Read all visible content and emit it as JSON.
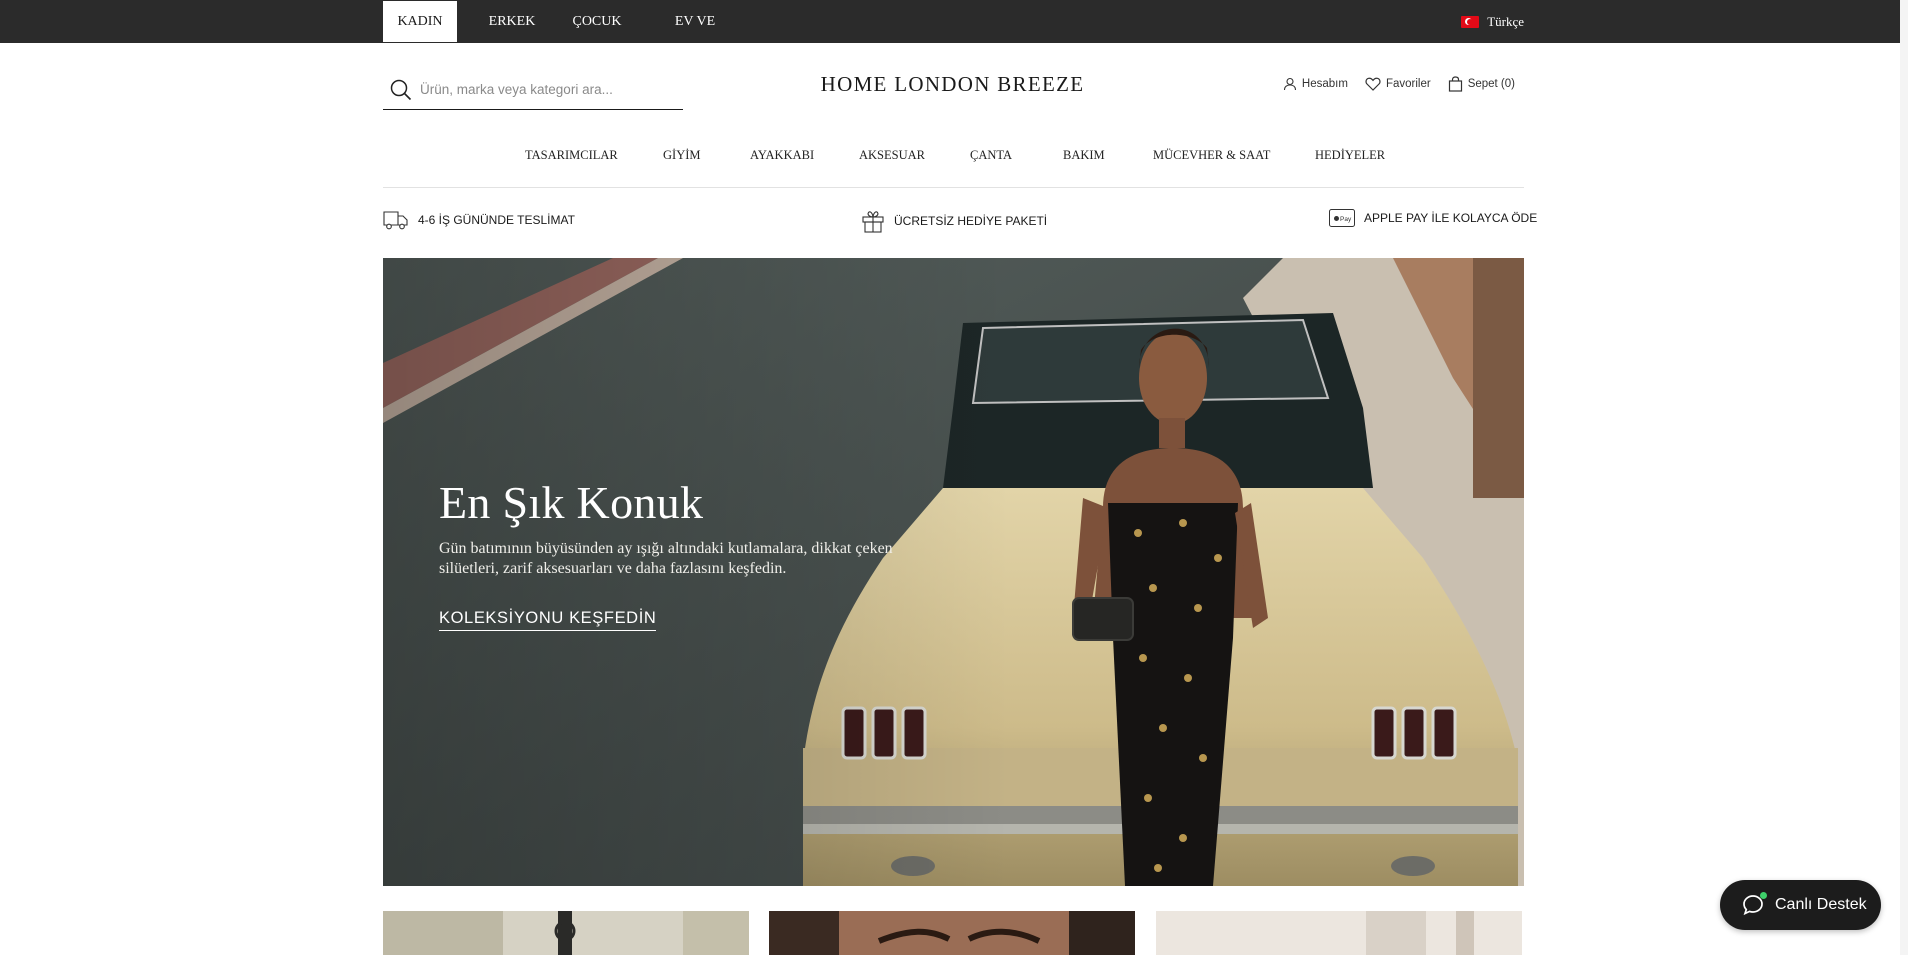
{
  "topbar": {
    "tabs": [
      {
        "label": "KADIN",
        "active": true
      },
      {
        "label": "ERKEK",
        "active": false
      },
      {
        "label": "ÇOCUK",
        "active": false
      },
      {
        "label": "EV VE YAŞAM",
        "active": false
      }
    ],
    "language": "Türkçe"
  },
  "header": {
    "search_placeholder": "Ürün, marka veya kategori ara...",
    "logo": "HOME LONDON BREEZE",
    "account": "Hesabım",
    "favorites": "Favoriler",
    "cart": "Sepet (0)"
  },
  "nav": {
    "items": [
      "TASARIMCILAR",
      "GİYİM",
      "AYAKKABI",
      "AKSESUAR",
      "ÇANTA",
      "BAKIM",
      "MÜCEVHER & SAAT",
      "HEDİYELER"
    ]
  },
  "usp": {
    "delivery": "4-6 İŞ GÜNÜNDE TESLİMAT",
    "gift": "ÜCRETSİZ HEDİYE PAKETİ",
    "pay": "APPLE PAY İLE KOLAYCA ÖDE",
    "pay_badge": "Pay"
  },
  "hero": {
    "title": "En Şık Konuk",
    "description": "Gün batımının büyüsünden ay ışığı altındaki kutlamalara, dikkat çeken silüetleri, zarif aksesuarları ve daha fazlasını keşfedin.",
    "cta": "KOLEKSİYONU KEŞFEDİN"
  },
  "chat": {
    "label": "Canlı Destek"
  },
  "colors": {
    "topbar": "#2b2b2b",
    "text": "#1a1a1a",
    "chat_bg": "#1c1c1c",
    "online": "#3ecf6a"
  }
}
